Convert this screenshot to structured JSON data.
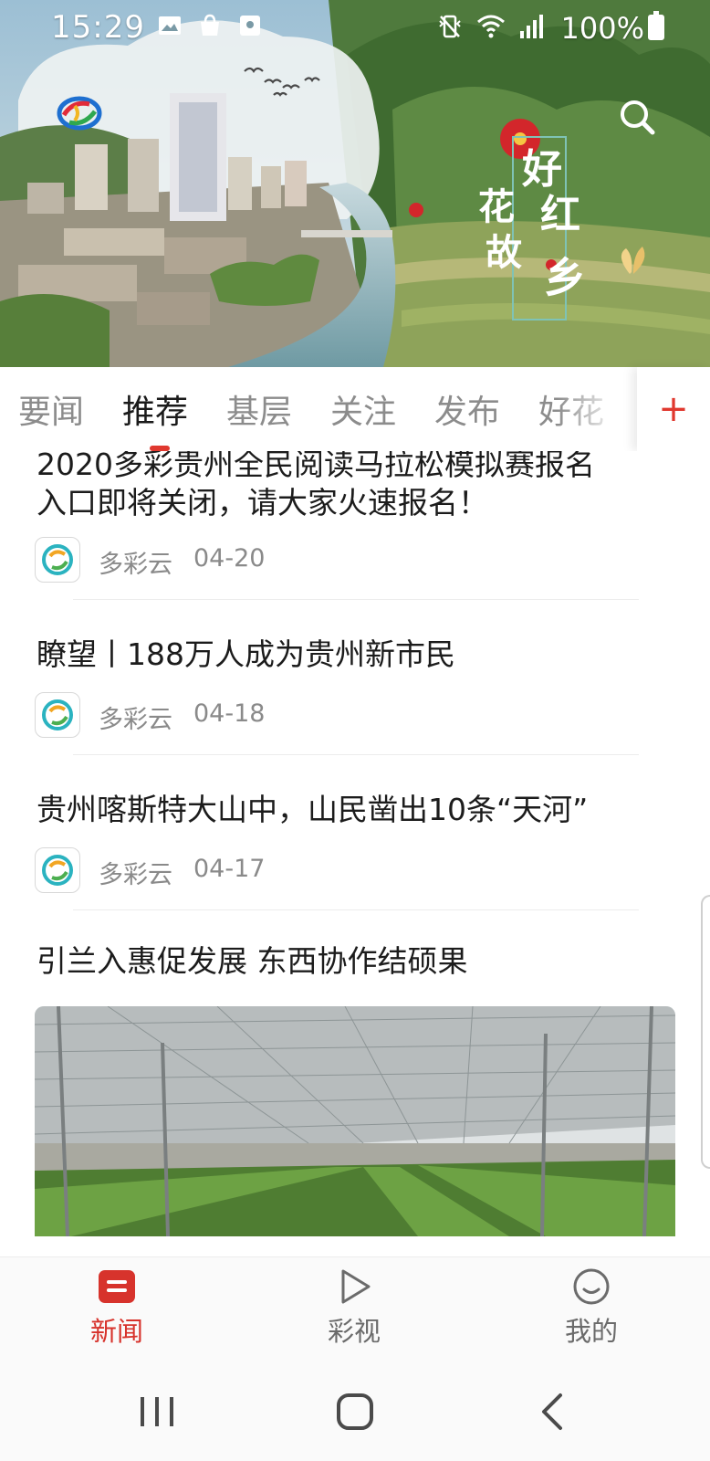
{
  "status_bar": {
    "time": "15:29",
    "battery_text": "100%",
    "left_icons": [
      "image-icon",
      "bag-icon",
      "lock-screen-icon"
    ],
    "right_icons": [
      "vibrate-icon",
      "wifi-icon",
      "signal-icon",
      "battery-icon"
    ]
  },
  "header": {
    "logo_icon": "app-logo-icon",
    "search_icon": "search-icon",
    "calligraphy_text": "好花红故乡"
  },
  "tabs": {
    "items": [
      {
        "label": "要闻",
        "active": false
      },
      {
        "label": "推荐",
        "active": true
      },
      {
        "label": "基层",
        "active": false
      },
      {
        "label": "关注",
        "active": false
      },
      {
        "label": "发布",
        "active": false
      },
      {
        "label": "好花",
        "active": false
      }
    ],
    "add_label": "+",
    "accent_color": "#e0382f"
  },
  "feed": {
    "items": [
      {
        "title_line1": "2020多彩贵州全民阅读马拉松模拟赛报名",
        "title_line2": "入口即将关闭，请大家火速报名！",
        "source": "多彩云",
        "date": "04-20"
      },
      {
        "title": "瞭望丨188万人成为贵州新市民",
        "source": "多彩云",
        "date": "04-18"
      },
      {
        "title": "贵州喀斯特大山中，山民凿出10条“天河”",
        "source": "多彩云",
        "date": "04-17"
      },
      {
        "title": "引兰入惠促发展 东西协作结硕果"
      }
    ]
  },
  "bottom_nav": {
    "items": [
      {
        "label": "新闻",
        "icon": "news-icon",
        "active": true
      },
      {
        "label": "彩视",
        "icon": "play-icon",
        "active": false
      },
      {
        "label": "我的",
        "icon": "smiley-icon",
        "active": false
      }
    ],
    "active_color": "#d7332c"
  },
  "system_nav": {
    "buttons": [
      "recent-apps-icon",
      "home-icon",
      "back-icon"
    ]
  }
}
